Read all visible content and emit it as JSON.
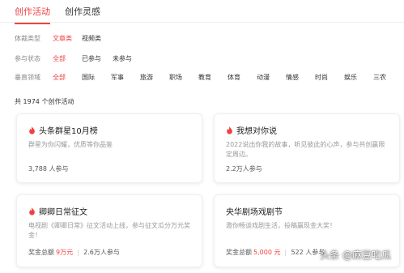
{
  "tabs": [
    "创作活动",
    "创作灵感"
  ],
  "filters": {
    "type": {
      "label": "体裁类型",
      "options": [
        "文章类",
        "视频类"
      ]
    },
    "status": {
      "label": "参与状态",
      "options": [
        "全部",
        "已参与",
        "未参与"
      ]
    },
    "vertical": {
      "label": "垂直领域",
      "options": [
        "全部",
        "国际",
        "军事",
        "旅游",
        "职场",
        "教育",
        "体育",
        "动漫",
        "情感",
        "时尚",
        "娱乐",
        "三农"
      ]
    }
  },
  "total_text": "共 1974 个创作活动",
  "cards": [
    {
      "title": "头条群星10月榜",
      "desc": "群星为你闪耀，优质等你品鉴",
      "participants": "3,788 人参与",
      "prize_label": "",
      "prize_value": ""
    },
    {
      "title": "我想对你说",
      "desc": "2022说出你我的故事，听见彼此的心声，参与共创赢限定周边。",
      "participants": "2.2万人参与",
      "prize_label": "",
      "prize_value": ""
    },
    {
      "title": "卿卿日常征文",
      "desc": "电视剧《卿卿日常》征文活动上线，参与征文瓜分万元奖金！",
      "participants": "2.6万人参与",
      "prize_label": "奖金总额",
      "prize_value": "9万元"
    },
    {
      "title": "央华剧场戏剧节",
      "desc": "邀你畅谈戏剧生活，投稿赢现金大奖！",
      "participants": "522 人参与",
      "prize_label": "奖金总额",
      "prize_value": "5,000 元"
    }
  ],
  "watermark": "头条 @麻豆吃瓜",
  "colors": {
    "accent": "#f04142",
    "muted": "#999999"
  }
}
